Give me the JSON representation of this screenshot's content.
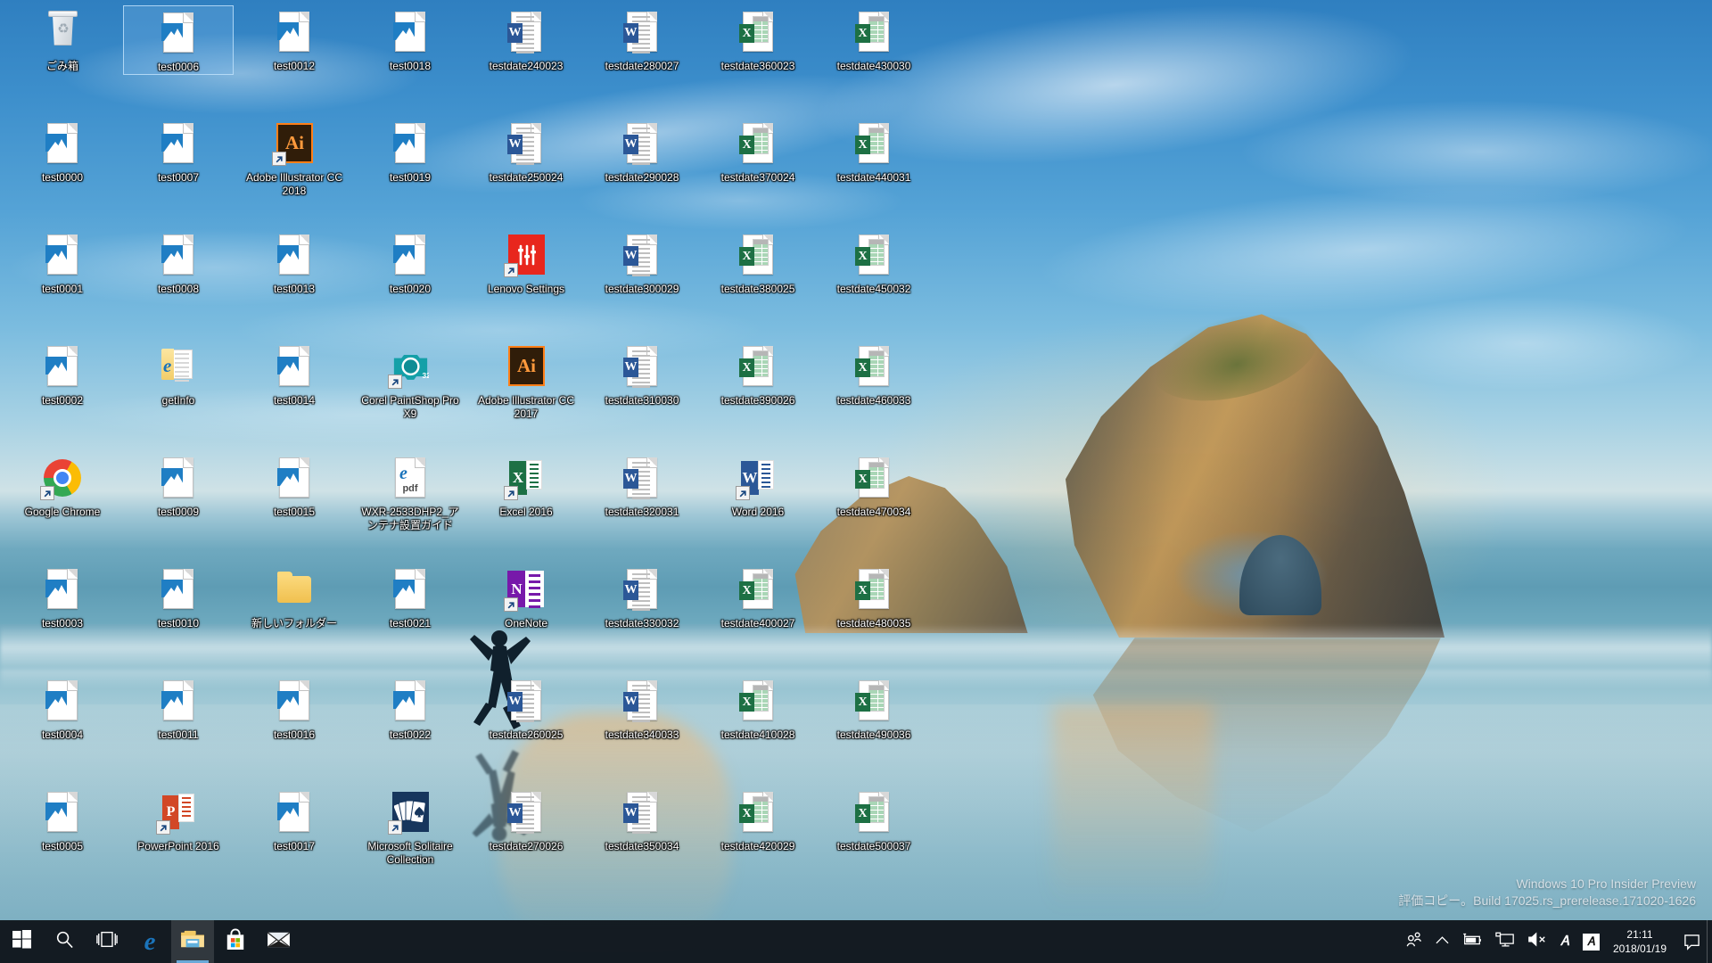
{
  "desktop": {
    "watermark": {
      "line1": "Windows 10 Pro Insider Preview",
      "line2": "評価コピー。Build 17025.rs_prerelease.171020-1626"
    },
    "icons": [
      {
        "label": "ごみ箱",
        "type": "recycle-bin",
        "col": 0,
        "row": 0,
        "shortcut": false,
        "selected": false
      },
      {
        "label": "test0006",
        "type": "image-file",
        "col": 1,
        "row": 0,
        "shortcut": false,
        "selected": true
      },
      {
        "label": "test0012",
        "type": "image-file",
        "col": 2,
        "row": 0,
        "shortcut": false,
        "selected": false
      },
      {
        "label": "test0018",
        "type": "image-file",
        "col": 3,
        "row": 0,
        "shortcut": false,
        "selected": false
      },
      {
        "label": "testdate240023",
        "type": "word-file",
        "col": 4,
        "row": 0,
        "shortcut": false,
        "selected": false
      },
      {
        "label": "testdate280027",
        "type": "word-file",
        "col": 5,
        "row": 0,
        "shortcut": false,
        "selected": false
      },
      {
        "label": "testdate360023",
        "type": "excel-file",
        "col": 6,
        "row": 0,
        "shortcut": false,
        "selected": false
      },
      {
        "label": "testdate430030",
        "type": "excel-file",
        "col": 7,
        "row": 0,
        "shortcut": false,
        "selected": false
      },
      {
        "label": "test0000",
        "type": "image-file",
        "col": 0,
        "row": 1,
        "shortcut": false,
        "selected": false
      },
      {
        "label": "test0007",
        "type": "image-file",
        "col": 1,
        "row": 1,
        "shortcut": false,
        "selected": false
      },
      {
        "label": "Adobe Illustrator CC 2018",
        "type": "illustrator",
        "col": 2,
        "row": 1,
        "shortcut": true,
        "selected": false
      },
      {
        "label": "test0019",
        "type": "image-file",
        "col": 3,
        "row": 1,
        "shortcut": false,
        "selected": false
      },
      {
        "label": "testdate250024",
        "type": "word-file",
        "col": 4,
        "row": 1,
        "shortcut": false,
        "selected": false
      },
      {
        "label": "testdate290028",
        "type": "word-file",
        "col": 5,
        "row": 1,
        "shortcut": false,
        "selected": false
      },
      {
        "label": "testdate370024",
        "type": "excel-file",
        "col": 6,
        "row": 1,
        "shortcut": false,
        "selected": false
      },
      {
        "label": "testdate440031",
        "type": "excel-file",
        "col": 7,
        "row": 1,
        "shortcut": false,
        "selected": false
      },
      {
        "label": "test0001",
        "type": "image-file",
        "col": 0,
        "row": 2,
        "shortcut": false,
        "selected": false
      },
      {
        "label": "test0008",
        "type": "image-file",
        "col": 1,
        "row": 2,
        "shortcut": false,
        "selected": false
      },
      {
        "label": "test0013",
        "type": "image-file",
        "col": 2,
        "row": 2,
        "shortcut": false,
        "selected": false
      },
      {
        "label": "test0020",
        "type": "image-file",
        "col": 3,
        "row": 2,
        "shortcut": false,
        "selected": false
      },
      {
        "label": "Lenovo Settings",
        "type": "lenovo",
        "col": 4,
        "row": 2,
        "shortcut": true,
        "selected": false
      },
      {
        "label": "testdate300029",
        "type": "word-file",
        "col": 5,
        "row": 2,
        "shortcut": false,
        "selected": false
      },
      {
        "label": "testdate380025",
        "type": "excel-file",
        "col": 6,
        "row": 2,
        "shortcut": false,
        "selected": false
      },
      {
        "label": "testdate450032",
        "type": "excel-file",
        "col": 7,
        "row": 2,
        "shortcut": false,
        "selected": false
      },
      {
        "label": "test0002",
        "type": "image-file",
        "col": 0,
        "row": 3,
        "shortcut": false,
        "selected": false
      },
      {
        "label": "getInfo",
        "type": "html-folder",
        "col": 1,
        "row": 3,
        "shortcut": false,
        "selected": false
      },
      {
        "label": "test0014",
        "type": "image-file",
        "col": 2,
        "row": 3,
        "shortcut": false,
        "selected": false
      },
      {
        "label": "Corel PaintShop Pro X9",
        "type": "corel",
        "col": 3,
        "row": 3,
        "shortcut": true,
        "selected": false
      },
      {
        "label": "Adobe Illustrator CC 2017",
        "type": "illustrator",
        "col": 4,
        "row": 3,
        "shortcut": false,
        "selected": false
      },
      {
        "label": "testdate310030",
        "type": "word-file",
        "col": 5,
        "row": 3,
        "shortcut": false,
        "selected": false
      },
      {
        "label": "testdate390026",
        "type": "excel-file",
        "col": 6,
        "row": 3,
        "shortcut": false,
        "selected": false
      },
      {
        "label": "testdate460033",
        "type": "excel-file",
        "col": 7,
        "row": 3,
        "shortcut": false,
        "selected": false
      },
      {
        "label": "Google Chrome",
        "type": "chrome",
        "col": 0,
        "row": 4,
        "shortcut": true,
        "selected": false
      },
      {
        "label": "test0009",
        "type": "image-file",
        "col": 1,
        "row": 4,
        "shortcut": false,
        "selected": false
      },
      {
        "label": "test0015",
        "type": "image-file",
        "col": 2,
        "row": 4,
        "shortcut": false,
        "selected": false
      },
      {
        "label": "WXR-2533DHP2_アンテナ設置ガイド",
        "type": "pdf-file",
        "col": 3,
        "row": 4,
        "shortcut": false,
        "selected": false
      },
      {
        "label": "Excel 2016",
        "type": "excel-app",
        "col": 4,
        "row": 4,
        "shortcut": true,
        "selected": false
      },
      {
        "label": "testdate320031",
        "type": "word-file",
        "col": 5,
        "row": 4,
        "shortcut": false,
        "selected": false
      },
      {
        "label": "Word 2016",
        "type": "word-app",
        "col": 6,
        "row": 4,
        "shortcut": true,
        "selected": false
      },
      {
        "label": "testdate470034",
        "type": "excel-file",
        "col": 7,
        "row": 4,
        "shortcut": false,
        "selected": false
      },
      {
        "label": "test0003",
        "type": "image-file",
        "col": 0,
        "row": 5,
        "shortcut": false,
        "selected": false
      },
      {
        "label": "test0010",
        "type": "image-file",
        "col": 1,
        "row": 5,
        "shortcut": false,
        "selected": false
      },
      {
        "label": "新しいフォルダー",
        "type": "folder",
        "col": 2,
        "row": 5,
        "shortcut": false,
        "selected": false
      },
      {
        "label": "test0021",
        "type": "image-file",
        "col": 3,
        "row": 5,
        "shortcut": false,
        "selected": false
      },
      {
        "label": "OneNote",
        "type": "onenote",
        "col": 4,
        "row": 5,
        "shortcut": true,
        "selected": false
      },
      {
        "label": "testdate330032",
        "type": "word-file",
        "col": 5,
        "row": 5,
        "shortcut": false,
        "selected": false
      },
      {
        "label": "testdate400027",
        "type": "excel-file",
        "col": 6,
        "row": 5,
        "shortcut": false,
        "selected": false
      },
      {
        "label": "testdate480035",
        "type": "excel-file",
        "col": 7,
        "row": 5,
        "shortcut": false,
        "selected": false
      },
      {
        "label": "test0004",
        "type": "image-file",
        "col": 0,
        "row": 6,
        "shortcut": false,
        "selected": false
      },
      {
        "label": "test0011",
        "type": "image-file",
        "col": 1,
        "row": 6,
        "shortcut": false,
        "selected": false
      },
      {
        "label": "test0016",
        "type": "image-file",
        "col": 2,
        "row": 6,
        "shortcut": false,
        "selected": false
      },
      {
        "label": "test0022",
        "type": "image-file",
        "col": 3,
        "row": 6,
        "shortcut": false,
        "selected": false
      },
      {
        "label": "testdate260025",
        "type": "word-file",
        "col": 4,
        "row": 6,
        "shortcut": false,
        "selected": false
      },
      {
        "label": "testdate340033",
        "type": "word-file",
        "col": 5,
        "row": 6,
        "shortcut": false,
        "selected": false
      },
      {
        "label": "testdate410028",
        "type": "excel-file",
        "col": 6,
        "row": 6,
        "shortcut": false,
        "selected": false
      },
      {
        "label": "testdate490036",
        "type": "excel-file",
        "col": 7,
        "row": 6,
        "shortcut": false,
        "selected": false
      },
      {
        "label": "test0005",
        "type": "image-file",
        "col": 0,
        "row": 7,
        "shortcut": false,
        "selected": false
      },
      {
        "label": "PowerPoint 2016",
        "type": "powerpoint-app",
        "col": 1,
        "row": 7,
        "shortcut": true,
        "selected": false
      },
      {
        "label": "test0017",
        "type": "image-file",
        "col": 2,
        "row": 7,
        "shortcut": false,
        "selected": false
      },
      {
        "label": "Microsoft Solitaire Collection",
        "type": "solitaire",
        "col": 3,
        "row": 7,
        "shortcut": true,
        "selected": false
      },
      {
        "label": "testdate270026",
        "type": "word-file",
        "col": 4,
        "row": 7,
        "shortcut": false,
        "selected": false
      },
      {
        "label": "testdate350034",
        "type": "word-file",
        "col": 5,
        "row": 7,
        "shortcut": false,
        "selected": false
      },
      {
        "label": "testdate420029",
        "type": "excel-file",
        "col": 6,
        "row": 7,
        "shortcut": false,
        "selected": false
      },
      {
        "label": "testdate500037",
        "type": "excel-file",
        "col": 7,
        "row": 7,
        "shortcut": false,
        "selected": false
      }
    ]
  },
  "taskbar": {
    "buttons": [
      {
        "name": "start-button",
        "icon": "windows-logo-icon",
        "label": "スタート",
        "active": false
      },
      {
        "name": "search-button",
        "icon": "search-icon",
        "label": "検索",
        "active": false
      },
      {
        "name": "task-view-button",
        "icon": "task-view-icon",
        "label": "タスク ビュー",
        "active": false
      },
      {
        "name": "edge-button",
        "icon": "edge-icon",
        "label": "Microsoft Edge",
        "active": false
      },
      {
        "name": "file-explorer-button",
        "icon": "file-explorer-icon",
        "label": "エクスプローラー",
        "active": true
      },
      {
        "name": "store-button",
        "icon": "store-icon",
        "label": "Microsoft Store",
        "active": false
      },
      {
        "name": "mail-button",
        "icon": "mail-icon",
        "label": "メール",
        "active": false
      }
    ],
    "tray": [
      {
        "name": "people-button",
        "icon": "people-icon",
        "label": "ユーザー"
      },
      {
        "name": "show-hidden-icons",
        "icon": "chevron-up-icon",
        "label": "隠れているインジケーターを表示します"
      },
      {
        "name": "battery-button",
        "icon": "battery-charging-icon",
        "label": "バッテリー"
      },
      {
        "name": "network-button",
        "icon": "network-monitor-icon",
        "label": "ネットワーク"
      },
      {
        "name": "volume-button",
        "icon": "speaker-muted-icon",
        "label": "音量"
      },
      {
        "name": "ime-mode-button",
        "icon": "ime-a-icon",
        "label": "A"
      },
      {
        "name": "ime-kana-button",
        "icon": "ime-box-icon",
        "label": "A"
      }
    ],
    "clock": {
      "time": "21:11",
      "date": "2018/01/19"
    },
    "action_center": {
      "name": "action-center-button",
      "icon": "speech-bubble-icon",
      "label": "アクション センター"
    },
    "show_desktop": {
      "name": "show-desktop-button",
      "label": "デスクトップの表示"
    }
  },
  "colors": {
    "taskbar_bg": "#0c1016",
    "selection": "#78b4e6",
    "accent": "#6aa9d8",
    "word_blue": "#2b5797",
    "excel_green": "#1d7044",
    "onenote_purple": "#7719aa",
    "powerpoint_orange": "#d24726",
    "lenovo_red": "#e8261d",
    "illustrator_orange": "#ff7f18"
  }
}
